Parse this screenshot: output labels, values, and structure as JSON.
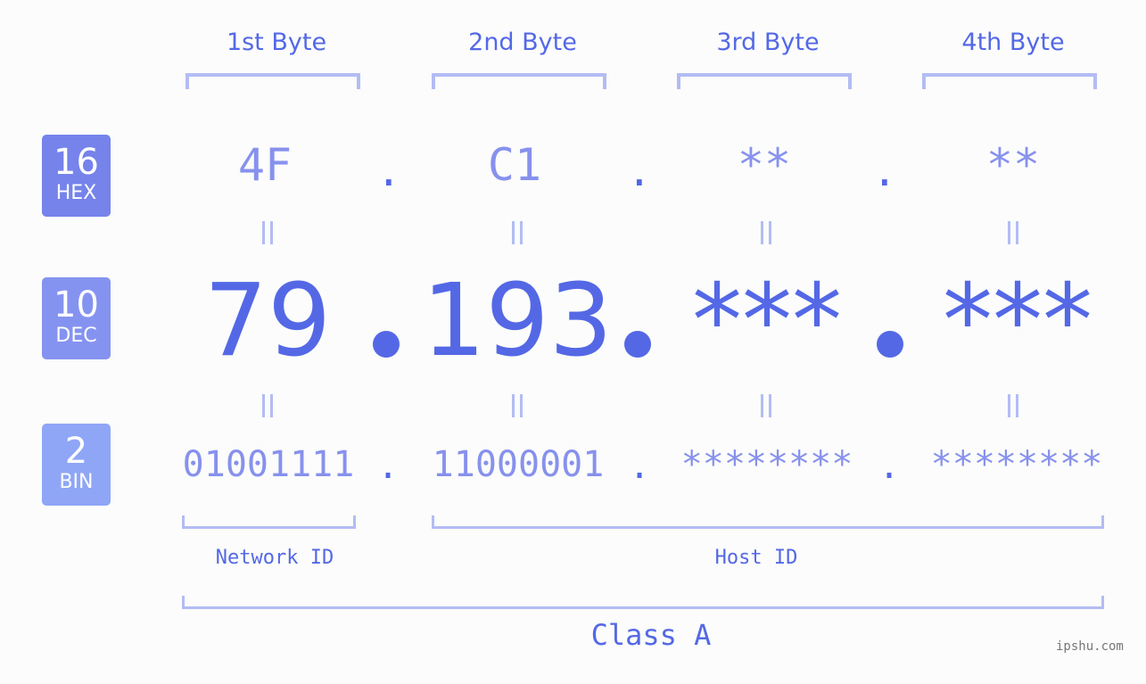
{
  "badges": [
    {
      "num": "16",
      "label": "HEX",
      "color": "#7583eb"
    },
    {
      "num": "10",
      "label": "DEC",
      "color": "#8593f0"
    },
    {
      "num": "2",
      "label": "BIN",
      "color": "#8fa6f6"
    }
  ],
  "byte_headers": [
    "1st Byte",
    "2nd Byte",
    "3rd Byte",
    "4th Byte"
  ],
  "hex": [
    "4F",
    "C1",
    "**",
    "**"
  ],
  "dec": [
    "79",
    "193",
    "***",
    "***"
  ],
  "bin": [
    "01001111",
    "11000001",
    "********",
    "********"
  ],
  "separator": ".",
  "labels": {
    "network_id": "Network ID",
    "host_id": "Host ID",
    "class": "Class A"
  },
  "watermark": "ipshu.com",
  "colors": {
    "accent": "#5468e6",
    "light": "#8791ed",
    "bracket": "#b3bcf4",
    "background": "#fbfcfb"
  }
}
